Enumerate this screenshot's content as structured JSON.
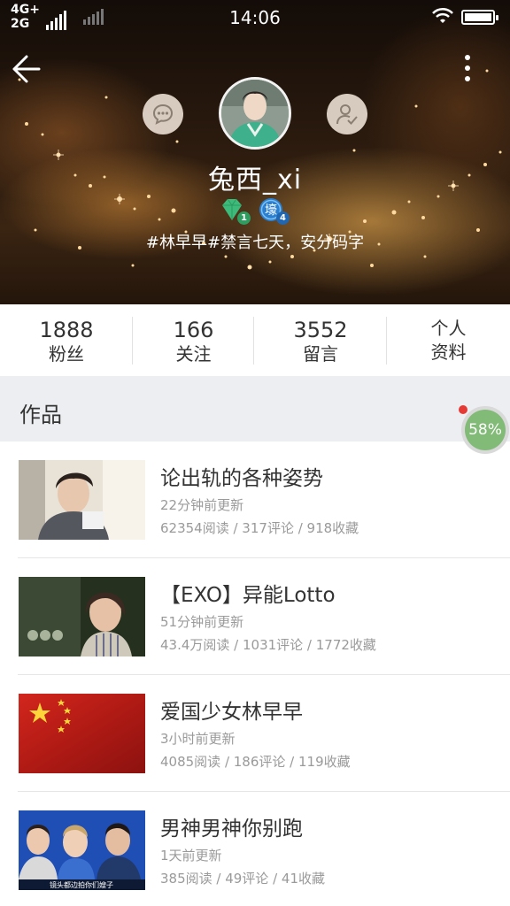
{
  "status_bar": {
    "network_top": "4G+",
    "network_bottom": "2G",
    "time": "14:06"
  },
  "header": {
    "back_icon": "arrow-left-icon",
    "more_icon": "more-vertical-icon",
    "chat_icon": "chat-bubble-icon",
    "follow_icon": "user-check-icon",
    "username": "兔西_xi",
    "badges": [
      {
        "icon": "green-gem-badge-icon",
        "number": "1"
      },
      {
        "icon": "blue-shield-badge-icon",
        "glyph": "壕",
        "number": "4"
      }
    ],
    "bio": "#林早早#禁言七天，安分码字"
  },
  "stats": [
    {
      "value": "1888",
      "label": "粉丝"
    },
    {
      "value": "166",
      "label": "关注"
    },
    {
      "value": "3552",
      "label": "留言"
    },
    {
      "line1": "个人",
      "line2": "资料"
    }
  ],
  "section": {
    "title": "作品",
    "progress_label": "58%",
    "progress_value": 0.58
  },
  "works": [
    {
      "title": "论出轨的各种姿势",
      "updated": "22分钟前更新",
      "meta": "62354阅读 / 317评论 / 918收藏"
    },
    {
      "title": "【EXO】异能Lotto",
      "updated": "51分钟前更新",
      "meta": "43.4万阅读 / 1031评论 / 1772收藏"
    },
    {
      "title": "爱国少女林早早",
      "updated": "3小时前更新",
      "meta": "4085阅读 / 186评论 / 119收藏"
    },
    {
      "title": "男神男神你别跑",
      "updated": "1天前更新",
      "meta": "385阅读 / 49评论 / 41收藏",
      "thumb_caption": "镜头都边拍你们嫂子"
    }
  ],
  "colors": {
    "progress_fill": "#82ba78",
    "section_bg": "#eceef1",
    "red_dot": "#e53935"
  }
}
